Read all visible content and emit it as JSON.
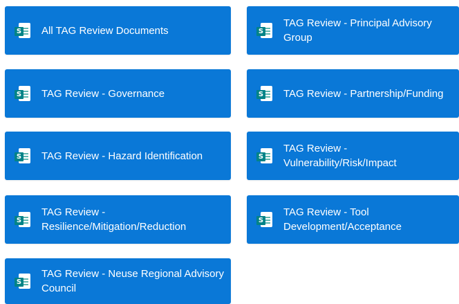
{
  "tiles": [
    {
      "label": "All TAG Review Documents",
      "icon": "sharepoint-list-icon",
      "icon_letter": "S"
    },
    {
      "label": "TAG Review - Principal Advisory Group",
      "icon": "sharepoint-list-icon",
      "icon_letter": "S"
    },
    {
      "label": "TAG Review - Governance",
      "icon": "sharepoint-list-icon",
      "icon_letter": "S"
    },
    {
      "label": "TAG Review - Partnership/Funding",
      "icon": "sharepoint-list-icon",
      "icon_letter": "S"
    },
    {
      "label": "TAG Review - Hazard Identification",
      "icon": "sharepoint-list-icon",
      "icon_letter": "S"
    },
    {
      "label": "TAG Review - Vulnerability/Risk/Impact",
      "icon": "sharepoint-list-icon",
      "icon_letter": "S"
    },
    {
      "label": "TAG Review - Resilience/Mitigation/Reduction",
      "icon": "sharepoint-list-icon",
      "icon_letter": "S"
    },
    {
      "label": "TAG Review - Tool Development/Acceptance",
      "icon": "sharepoint-list-icon",
      "icon_letter": "S"
    },
    {
      "label": "TAG Review - Neuse Regional Advisory Council",
      "icon": "sharepoint-list-icon",
      "icon_letter": "S"
    }
  ],
  "colors": {
    "tile_background": "#0a78d7",
    "tile_text": "#ffffff",
    "icon_badge": "#038387"
  }
}
